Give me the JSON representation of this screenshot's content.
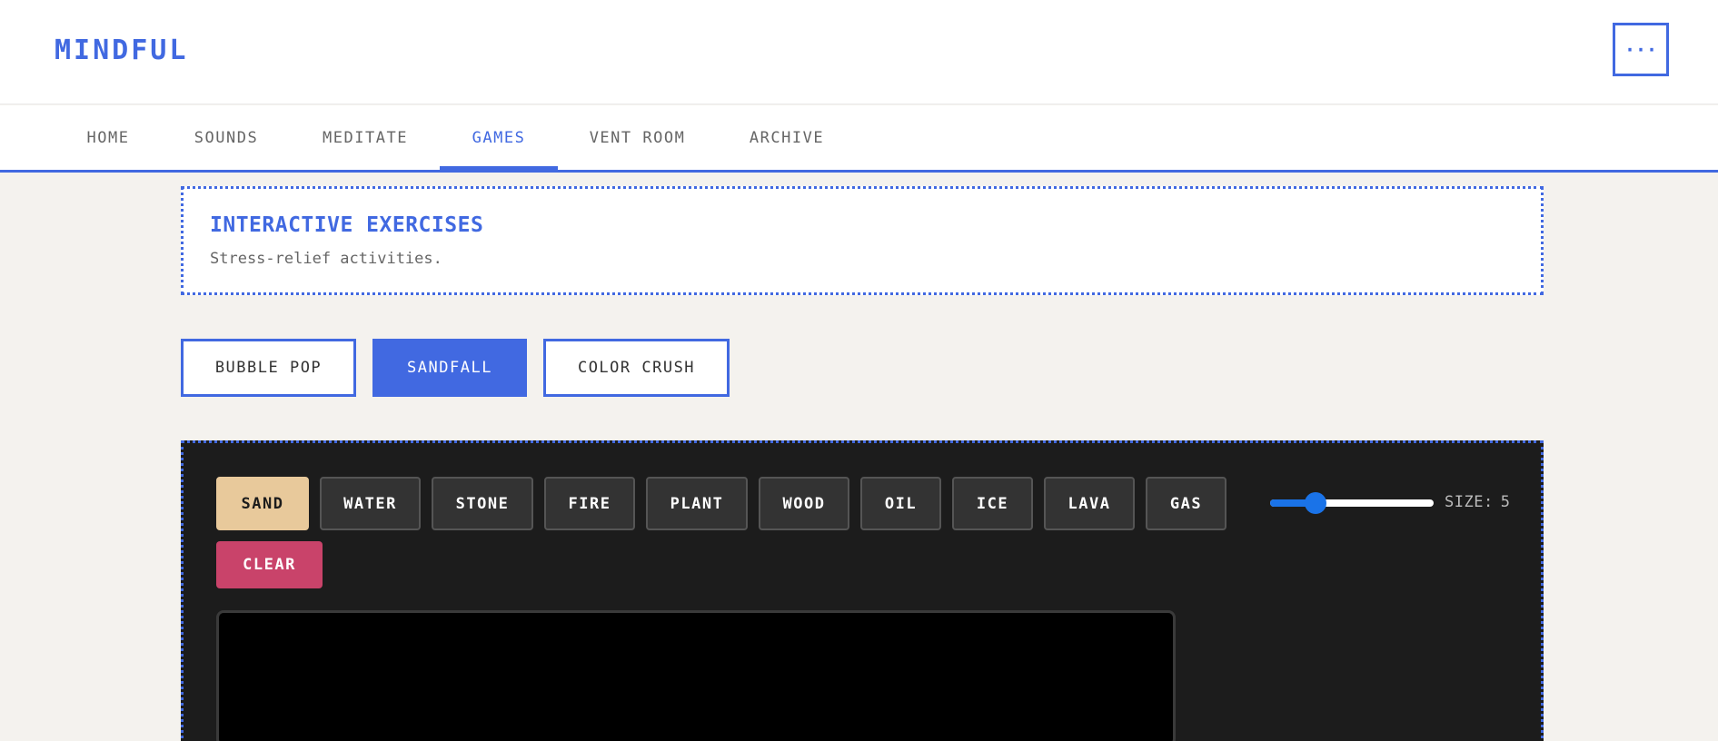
{
  "header": {
    "logo": "MINDFUL",
    "menu_label": "···"
  },
  "nav": {
    "items": [
      {
        "label": "HOME",
        "active": false
      },
      {
        "label": "SOUNDS",
        "active": false
      },
      {
        "label": "MEDITATE",
        "active": false
      },
      {
        "label": "GAMES",
        "active": true
      },
      {
        "label": "VENT ROOM",
        "active": false
      },
      {
        "label": "ARCHIVE",
        "active": false
      }
    ]
  },
  "intro": {
    "title": "INTERACTIVE EXERCISES",
    "subtitle": "Stress-relief activities."
  },
  "games": {
    "tabs": [
      {
        "label": "BUBBLE POP",
        "active": false
      },
      {
        "label": "SANDFALL",
        "active": true
      },
      {
        "label": "COLOR CRUSH",
        "active": false
      }
    ]
  },
  "sandfall": {
    "materials": [
      {
        "label": "SAND",
        "selected": true
      },
      {
        "label": "WATER",
        "selected": false
      },
      {
        "label": "STONE",
        "selected": false
      },
      {
        "label": "FIRE",
        "selected": false
      },
      {
        "label": "PLANT",
        "selected": false
      },
      {
        "label": "WOOD",
        "selected": false
      },
      {
        "label": "OIL",
        "selected": false
      },
      {
        "label": "ICE",
        "selected": false
      },
      {
        "label": "LAVA",
        "selected": false
      },
      {
        "label": "GAS",
        "selected": false
      }
    ],
    "clear_label": "CLEAR",
    "size_label": "SIZE:",
    "size_value": "5",
    "size_min": 1,
    "size_max": 20
  },
  "colors": {
    "accent": "#4169e1",
    "sand": "#e8c99b",
    "clear": "#c9436a",
    "panel": "#1c1c1c"
  }
}
